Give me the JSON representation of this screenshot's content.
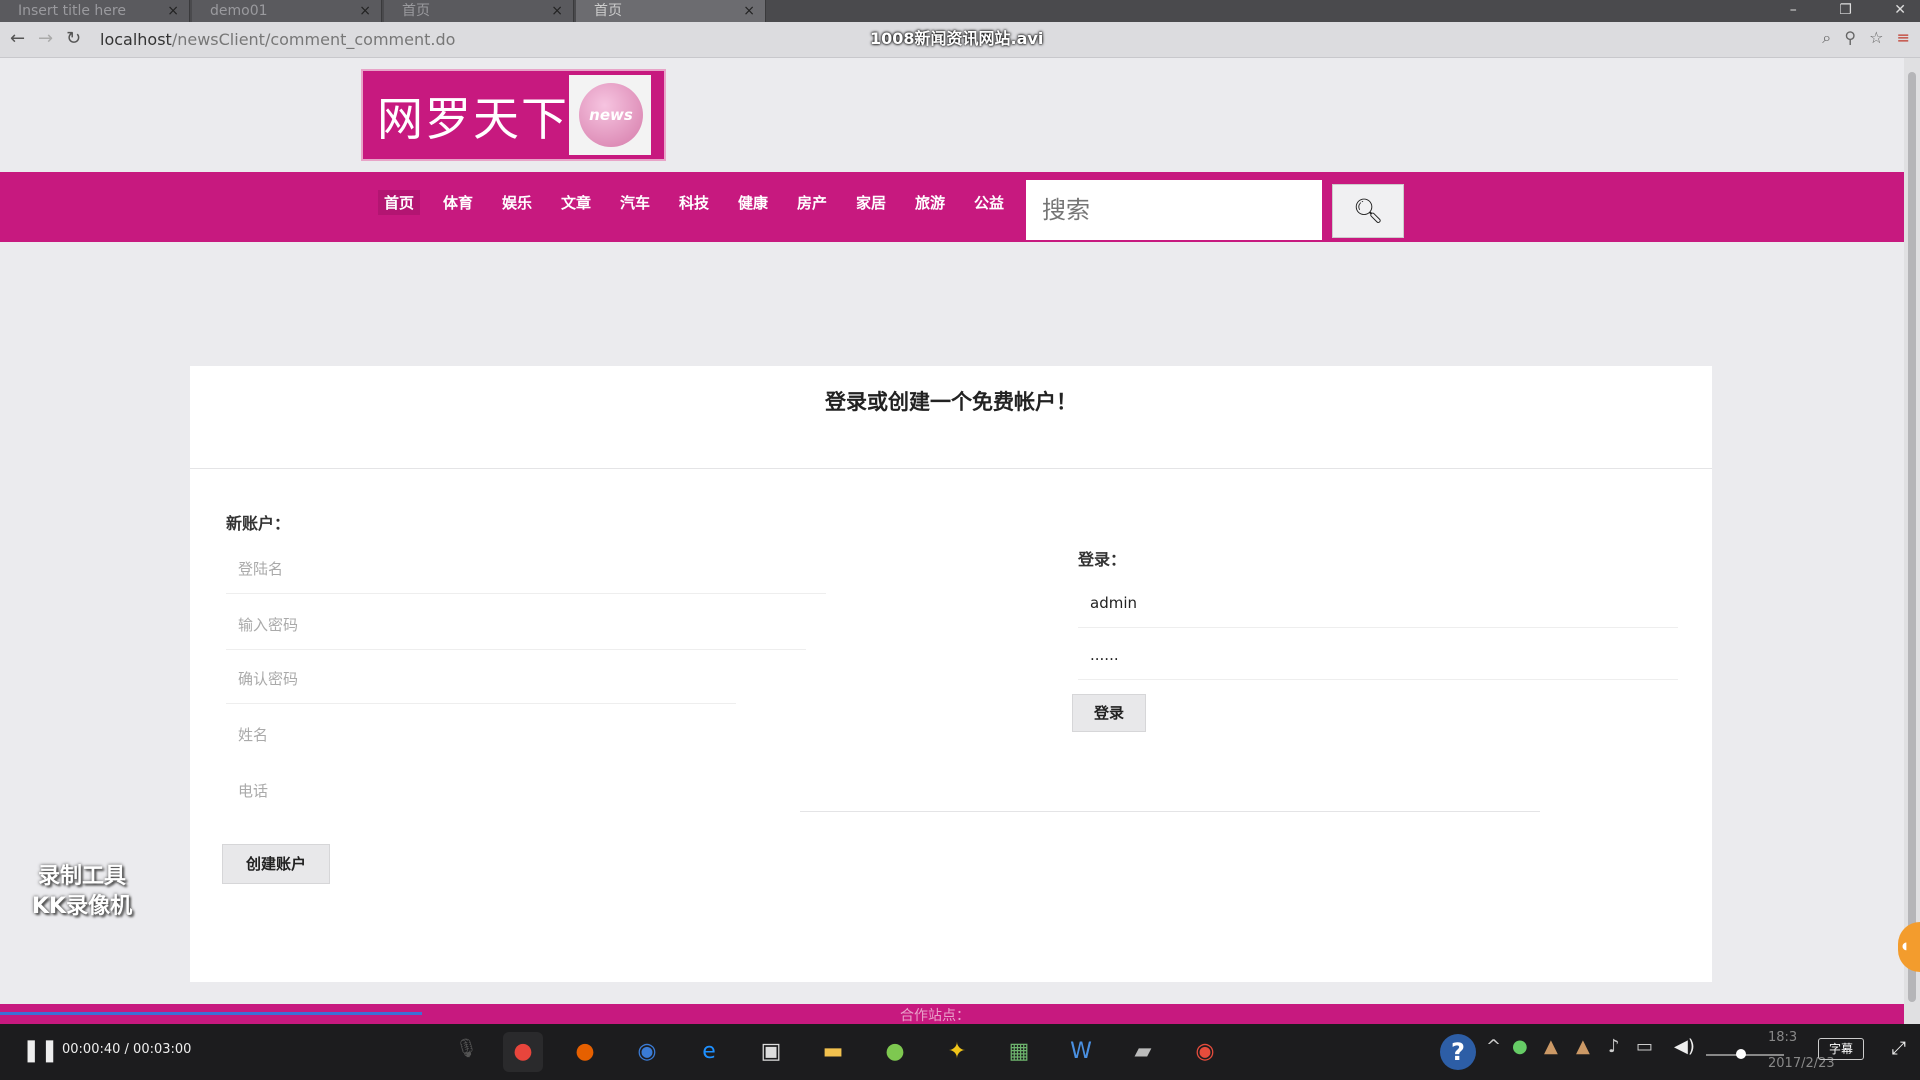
{
  "browser": {
    "tabs": [
      {
        "label": "Insert title here",
        "active": false
      },
      {
        "label": "demo01",
        "active": false
      },
      {
        "label": "首页",
        "active": false
      },
      {
        "label": "首页",
        "active": true
      }
    ],
    "url_host": "localhost",
    "url_path": "/newsClient/comment_comment.do"
  },
  "video": {
    "title": "1008新闻资讯网站.avi",
    "current_time": "00:00:40",
    "total_time": "00:03:00",
    "progress_fraction": 0.22,
    "subtitle_label": "字幕"
  },
  "site": {
    "logo_text": "网罗天下",
    "logo_badge": "news",
    "nav": [
      "首页",
      "体育",
      "娱乐",
      "文章",
      "汽车",
      "科技",
      "健康",
      "房产",
      "家居",
      "旅游",
      "公益"
    ],
    "search_placeholder": "搜索",
    "footer_label": "合作站点："
  },
  "form": {
    "title": "登录或创建一个免费帐户！",
    "register": {
      "label": "新账户：",
      "placeholders": [
        "登陆名",
        "输入密码",
        "确认密码",
        "姓名",
        "电话"
      ],
      "button": "创建账户"
    },
    "login": {
      "label": "登录：",
      "username_value": "admin",
      "password_value": "......",
      "button": "登录"
    }
  },
  "watermark": {
    "line1": "录制工具",
    "line2": "KK录像机"
  },
  "taskbar": {
    "clock_time": "18:3",
    "clock_date": "2017/2/23"
  },
  "colors": {
    "brand": "#c7197f",
    "progress": "#3d6fd6"
  }
}
